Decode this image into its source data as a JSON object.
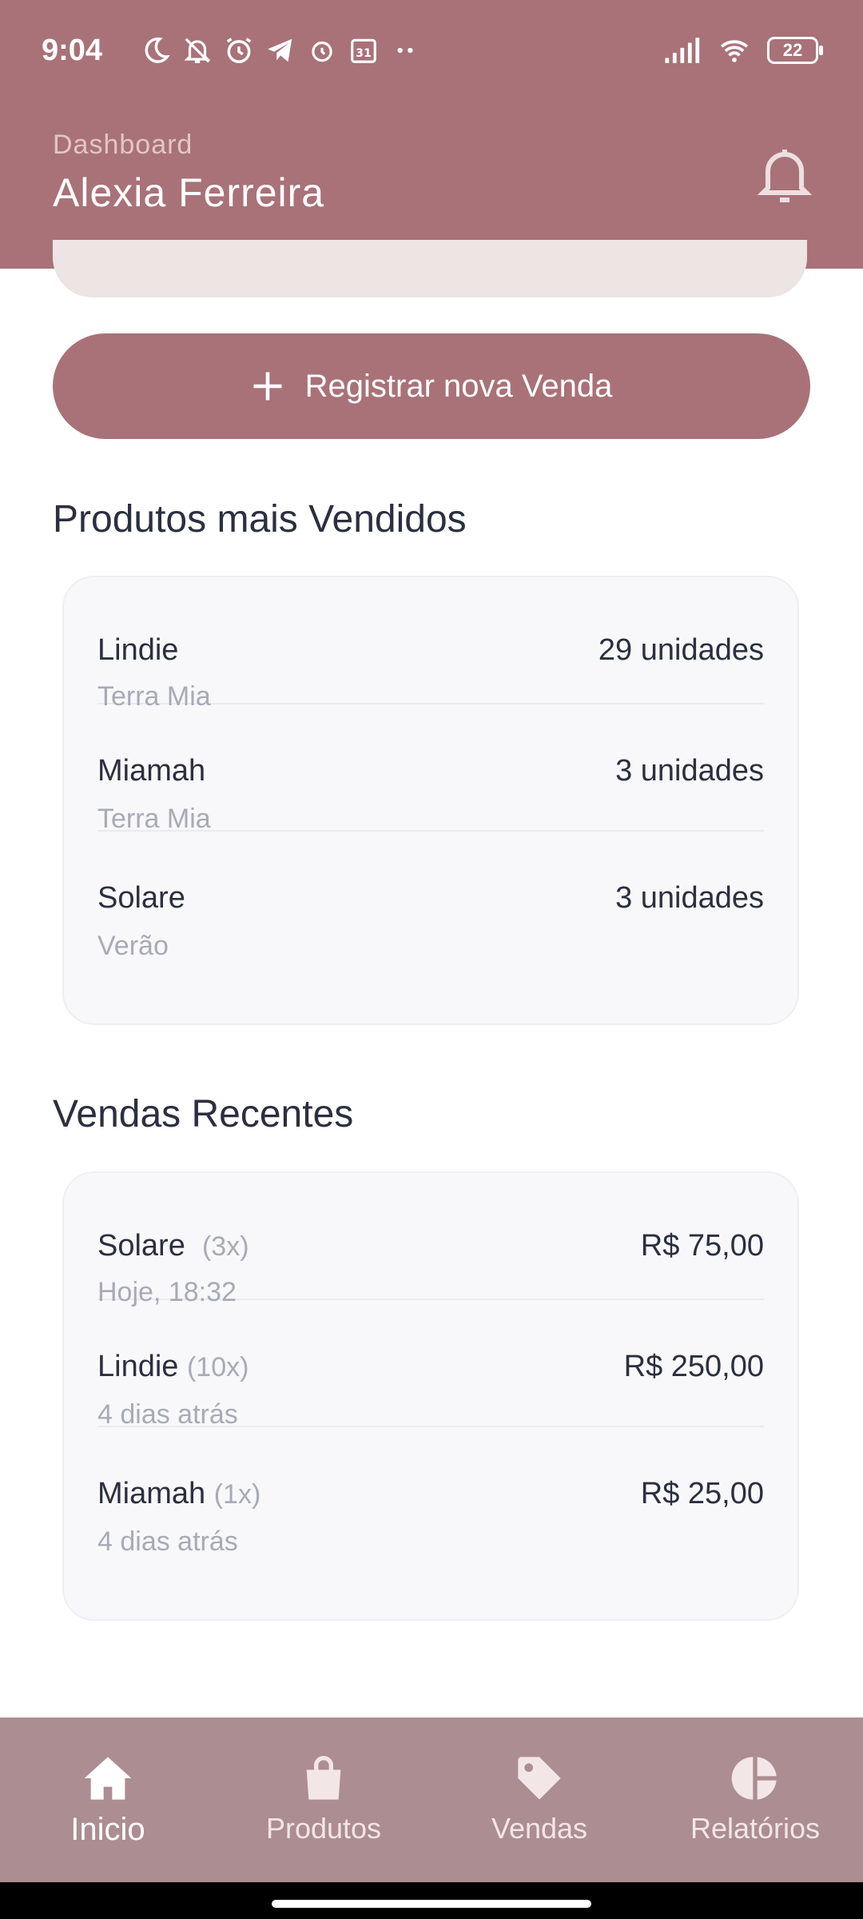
{
  "status_bar": {
    "time": "9:04",
    "battery": "22"
  },
  "header": {
    "subtitle": "Dashboard",
    "title": "Alexia Ferreira"
  },
  "actions": {
    "register_sale_label": "Registrar nova Venda"
  },
  "top_products": {
    "title": "Produtos mais Vendidos",
    "items": [
      {
        "name": "Lindie",
        "collection": "Terra Mia",
        "units": "29 unidades"
      },
      {
        "name": "Miamah",
        "collection": "Terra Mia",
        "units": "3 unidades"
      },
      {
        "name": "Solare",
        "collection": "Verão",
        "units": "3 unidades"
      }
    ]
  },
  "recent_sales": {
    "title": "Vendas Recentes",
    "items": [
      {
        "name": "Solare",
        "qty": "(3x)",
        "when": "Hoje, 18:32",
        "amount": "R$ 75,00"
      },
      {
        "name": "Lindie",
        "qty": "(10x)",
        "when": "4 dias atrás",
        "amount": "R$ 250,00"
      },
      {
        "name": "Miamah",
        "qty": "(1x)",
        "when": "4 dias atrás",
        "amount": "R$ 25,00"
      }
    ]
  },
  "bottom_nav": {
    "items": [
      {
        "label": "Inicio",
        "icon": "home-icon"
      },
      {
        "label": "Produtos",
        "icon": "shopping-bag-icon"
      },
      {
        "label": "Vendas",
        "icon": "tag-icon"
      },
      {
        "label": "Relatórios",
        "icon": "pie-chart-icon"
      }
    ]
  },
  "colors": {
    "primary": "#a87278",
    "nav_bg": "#ac8d91",
    "text": "#2b2f3f",
    "muted": "#a8abb6"
  }
}
